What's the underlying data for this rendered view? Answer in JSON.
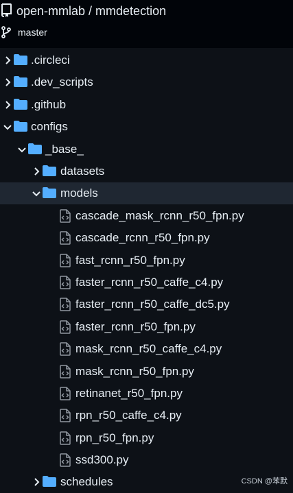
{
  "header": {
    "repo_title": "open-mmlab / mmdetection",
    "branch": "master",
    "repo_icon": "repo-icon",
    "branch_icon": "git-branch-icon"
  },
  "colors": {
    "background": "#010409",
    "tree_background": "#0d1117",
    "selected_row": "#1f2732",
    "folder": "#54aeff",
    "text": "#e6edf3",
    "icon_gray": "#9198a1"
  },
  "tree": {
    "circleci": ".circleci",
    "dev_scripts": ".dev_scripts",
    "github": ".github",
    "configs": "configs",
    "base": "_base_",
    "datasets": "datasets",
    "models": "models",
    "files": [
      "cascade_mask_rcnn_r50_fpn.py",
      "cascade_rcnn_r50_fpn.py",
      "fast_rcnn_r50_fpn.py",
      "faster_rcnn_r50_caffe_c4.py",
      "faster_rcnn_r50_caffe_dc5.py",
      "faster_rcnn_r50_fpn.py",
      "mask_rcnn_r50_caffe_c4.py",
      "mask_rcnn_r50_fpn.py",
      "retinanet_r50_fpn.py",
      "rpn_r50_caffe_c4.py",
      "rpn_r50_fpn.py",
      "ssd300.py"
    ],
    "schedules": "schedules",
    "selected": "models"
  },
  "watermark": "CSDN @苯默"
}
